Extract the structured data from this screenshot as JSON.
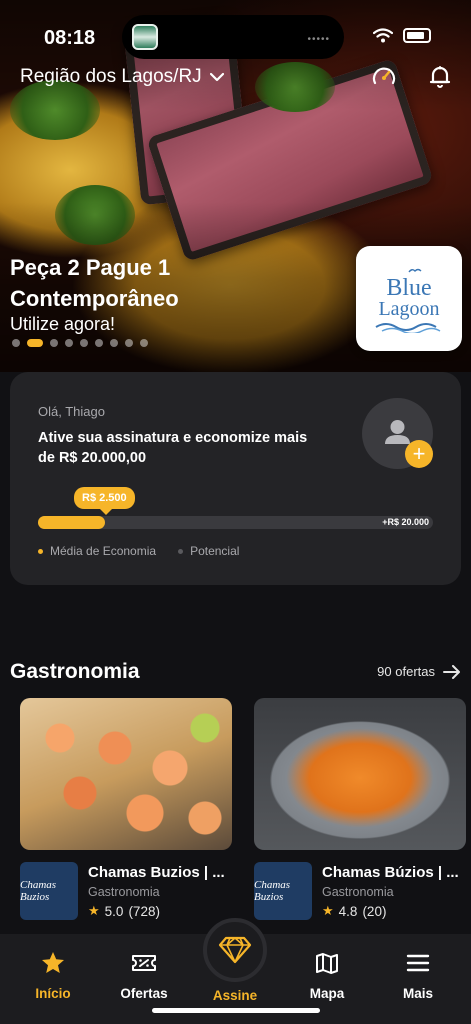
{
  "status_bar": {
    "time": "08:18"
  },
  "header": {
    "region": "Região dos Lagos/RJ"
  },
  "hero": {
    "offer_title": "Peça 2 Pague 1 Contemporâneo",
    "offer_subtitle": "Utilize agora!",
    "pager": {
      "total": 9,
      "active_index": 1
    },
    "partner_logo_text": [
      "Blue",
      "Lagoon"
    ]
  },
  "subscription": {
    "greeting": "Olá, Thiago",
    "message": "Ative sua assinatura e economize mais de  R$ 20.000,00",
    "bubble": "R$ 2.500",
    "progress_fraction": 0.17,
    "track_end_label": "+R$ 20.000",
    "legend": [
      "Média de Economia",
      "Potencial"
    ]
  },
  "section": {
    "title": "Gastronomia",
    "see_all": "90 ofertas"
  },
  "cards": [
    {
      "name": "Chamas Buzios | ...",
      "category": "Gastronomia",
      "rating": "5.0",
      "reviews": "(728)",
      "logo_text": "Chamas Buzios"
    },
    {
      "name": "Chamas Búzios | ...",
      "category": "Gastronomia",
      "rating": "4.8",
      "reviews": "(20)",
      "logo_text": "Chamas Buzios"
    }
  ],
  "tabs": [
    {
      "label": "Início",
      "icon": "star-icon"
    },
    {
      "label": "Ofertas",
      "icon": "ticket-icon"
    },
    {
      "label": "Assine",
      "icon": "diamond-icon"
    },
    {
      "label": "Mapa",
      "icon": "map-icon"
    },
    {
      "label": "Mais",
      "icon": "menu-icon"
    }
  ],
  "colors": {
    "accent": "#f6b529",
    "card": "#232326",
    "background": "#111114"
  }
}
